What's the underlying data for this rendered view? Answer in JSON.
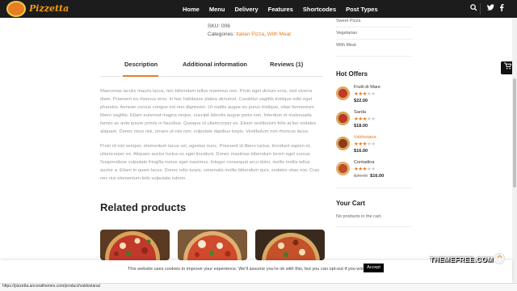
{
  "header": {
    "logo_text": "Pizzetta",
    "nav": [
      "Home",
      "Menu",
      "Delivery",
      "Features",
      "Shortcodes",
      "Post Types"
    ],
    "icons": [
      "search-icon",
      "twitter-icon",
      "facebook-icon"
    ]
  },
  "product": {
    "sku_label": "SKU:",
    "sku": "006",
    "categories_label": "Categories:",
    "categories": [
      "Italian Pizza",
      "With Meat"
    ],
    "categories_sep": ","
  },
  "tabs": [
    "Description",
    "Additional information",
    "Reviews (1)"
  ],
  "active_tab": "Description",
  "description": [
    "Maecenas iaculis mauris lacus, nec bibendum tellus maximus non. Proin eget dictum eros, sed viverra diam. Praesent eu rhoncus eros. In hac habitasse platea dictumst. Curabitur sagittis tristique odio eget pharetra. Aenean cursus congue est non dignissim. Ut mattis augue eu purus tristique, vitae fermentum libero sagittis. Etiam euismod magna neque, suscipit lobortis augue porta non. Interdum et malesuada fames ac ante ipsum primis in faucibus. Quisque id ullamcorper ex. Etiam vestibulum felis at leo sodales aliquam. Donec risus nisi, ornare ut nisi non, vulputate dapibus turpis. Vestibulum non rhoncus lacus.",
    "Proin id nisl semper, elementum lacus vel, egestas nunc. Praesent id libero luctus, tincidunt sapien et, ullamcorper ex. Aliquam auctor luctus ex eget tincidunt. Donec maximus bibendum lorem eget cursus. Suspendisse vulputate fringilla metus eget maximus. Integer consequat arcu dolor, mollis mollis tellus auctor a. Etiam in quam lacus. Donec odio turpis, venenatis mollis bibendum quis, sodales vitae nisi. Cras nec nisi elementum felis vulputate rutrum."
  ],
  "related": {
    "title": "Related products"
  },
  "sidebar": {
    "categories": [
      "Sweet Pizza",
      "Vegetarian",
      "With Meat"
    ],
    "hot_offers_title": "Hot Offers",
    "hot_offers": [
      {
        "name": "Frutti di Mare",
        "rating": 3,
        "price": "$22.00",
        "old_price": "",
        "highlight": false
      },
      {
        "name": "Sarda",
        "rating": 3,
        "price": "$18.00",
        "old_price": "",
        "highlight": false
      },
      {
        "name": "Valdostana",
        "rating": 3,
        "price": "$16.00",
        "old_price": "",
        "highlight": true
      },
      {
        "name": "Contadina",
        "rating": 3,
        "price": "$16.00",
        "old_price": "$20.00",
        "highlight": false
      }
    ],
    "cart_title": "Your Cart",
    "cart_empty": "No products in the cart."
  },
  "cookie": {
    "text": "This website uses cookies to improve your experience. We'll assume you're ok with this, but you can opt-out if you wish.",
    "accept": "Accept"
  },
  "watermark": "THEMEFREE.COM",
  "status_url": "https://pizzetta.ancorathemes.com/product/valdostana/",
  "colors": {
    "accent": "#e67e22",
    "header_bg": "#1c1c1c"
  }
}
